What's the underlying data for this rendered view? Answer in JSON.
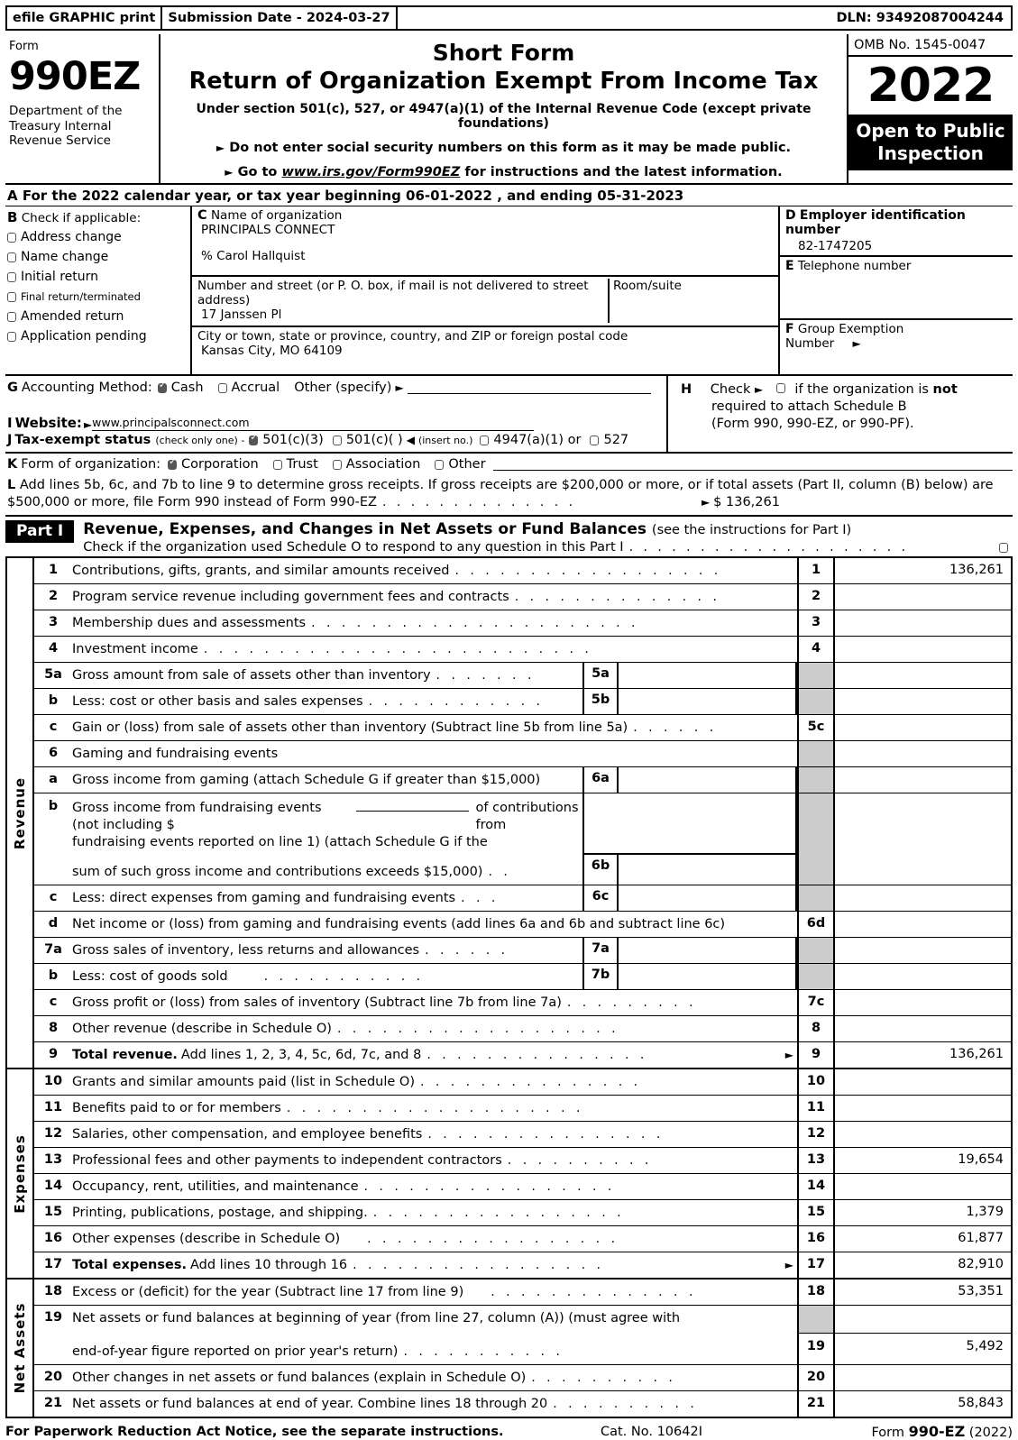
{
  "efile": {
    "graphic_print": "efile GRAPHIC print",
    "submission_date": "Submission Date - 2024-03-27",
    "dln": "DLN: 93492087004244"
  },
  "masthead": {
    "form_label": "Form",
    "form_number": "990EZ",
    "department": "Department of the Treasury Internal Revenue Service",
    "title_line1": "Short Form",
    "title_line2": "Return of Organization Exempt From Income Tax",
    "subtitle": "Under section 501(c), 527, or 4947(a)(1) of the Internal Revenue Code (except private foundations)",
    "notice_ssn": "Do not enter social security numbers on this form as it may be made public.",
    "notice_goto_pre": "Go to ",
    "notice_goto_url": "www.irs.gov/Form990EZ",
    "notice_goto_post": " for instructions and the latest information.",
    "omb": "OMB No. 1545-0047",
    "year": "2022",
    "open_to_public": "Open to Public Inspection"
  },
  "lineA": {
    "letter": "A",
    "text_pre": "For the 2022 calendar year, or tax year beginning",
    "begin_date": "06-01-2022",
    "text_mid": ", and ending",
    "end_date": "05-31-2023"
  },
  "sectionB": {
    "letter": "B",
    "heading": "Check if applicable:",
    "items": [
      {
        "label": "Address change",
        "checked": false
      },
      {
        "label": "Name change",
        "checked": false
      },
      {
        "label": "Initial return",
        "checked": false
      },
      {
        "label": "Final return/terminated",
        "checked": false
      },
      {
        "label": "Amended return",
        "checked": false
      },
      {
        "label": "Application pending",
        "checked": false
      }
    ]
  },
  "sectionC": {
    "letter": "C",
    "name_caption": "Name of organization",
    "org_name": "PRINCIPALS CONNECT",
    "care_of": "% Carol Hallquist",
    "street_caption": "Number and street (or P. O. box, if mail is not delivered to street address)",
    "room_caption": "Room/suite",
    "street": "17 Janssen Pl",
    "room": "",
    "city_caption": "City or town, state or province, country, and ZIP or foreign postal code",
    "city": "Kansas City, MO   64109"
  },
  "sectionD": {
    "letter": "D",
    "caption": "Employer identification number",
    "value": "82-1747205"
  },
  "sectionE": {
    "letter": "E",
    "caption": "Telephone number",
    "value": ""
  },
  "sectionF": {
    "letter": "F",
    "caption_line1": "Group Exemption",
    "caption_line2": "Number"
  },
  "sectionG": {
    "letter": "G",
    "label": "Accounting Method:",
    "cash_label": "Cash",
    "cash_checked": true,
    "accrual_label": "Accrual",
    "accrual_checked": false,
    "other_label": "Other (specify)",
    "other_value": ""
  },
  "sectionH": {
    "letter": "H",
    "line1_pre": "Check",
    "line1_post": "if the organization is ",
    "line1_bold": "not",
    "line2": "required to attach Schedule B",
    "line3": "(Form 990, 990-EZ, or 990-PF).",
    "checked": false
  },
  "sectionI": {
    "letter": "I",
    "label": "Website:",
    "value": "www.principalsconnect.com"
  },
  "sectionJ": {
    "letter": "J",
    "label": "Tax-exempt status",
    "hint": "(check only one) -",
    "opt1": "501(c)(3)",
    "opt1_checked": true,
    "opt2": "501(c)(    )",
    "opt2_checked": false,
    "insert_no": "(insert no.)",
    "opt3": "4947(a)(1) or",
    "opt3_checked": false,
    "opt4": "527",
    "opt4_checked": false
  },
  "sectionK": {
    "letter": "K",
    "label": "Form of organization:",
    "options": [
      {
        "label": "Corporation",
        "checked": true
      },
      {
        "label": "Trust",
        "checked": false
      },
      {
        "label": "Association",
        "checked": false
      },
      {
        "label": "Other",
        "checked": false
      }
    ]
  },
  "sectionL": {
    "letter": "L",
    "line1": "Add lines 5b, 6c, and 7b to line 9 to determine gross receipts. If gross receipts are $200,000 or more, or if total assets (Part II, column (B) below) are",
    "line2": "$500,000 or more, file Form 990 instead of Form 990-EZ",
    "amount": "$ 136,261"
  },
  "partI": {
    "tag": "Part I",
    "title": "Revenue, Expenses, and Changes in Net Assets or Fund Balances",
    "title_note": "(see the instructions for Part I)",
    "check_line": "Check if the organization used Schedule O to respond to any question in this Part I",
    "checked": false
  },
  "revenue": {
    "vertical_label": "Revenue",
    "rows": [
      {
        "no": "1",
        "desc": "Contributions, gifts, grants, and similar amounts received",
        "dots": true,
        "box": "1",
        "amount": "136,261"
      },
      {
        "no": "2",
        "desc": "Program service revenue including government fees and contracts",
        "dots": true,
        "box": "2",
        "amount": ""
      },
      {
        "no": "3",
        "desc": "Membership dues and assessments",
        "dots": true,
        "box": "3",
        "amount": ""
      },
      {
        "no": "4",
        "desc": "Investment income",
        "dots": true,
        "box": "4",
        "amount": ""
      },
      {
        "no": "5a",
        "desc": "Gross amount from sale of assets other than inventory",
        "dots": true,
        "sub": "5a",
        "sub_amount": "",
        "gray": true
      },
      {
        "no": "b",
        "desc": "Less: cost or other basis and sales expenses",
        "dots": true,
        "sub": "5b",
        "sub_amount": "",
        "gray": true
      },
      {
        "no": "c",
        "desc": "Gain or (loss) from sale of assets other than inventory (Subtract line 5b from line 5a)",
        "dots": true,
        "box": "5c",
        "amount": ""
      },
      {
        "no": "6",
        "desc": "Gaming and fundraising events",
        "dots": false,
        "gray": true
      },
      {
        "no": "a",
        "desc": "Gross income from gaming (attach Schedule G if greater than $15,000)",
        "dots": false,
        "sub": "6a",
        "sub_amount": "",
        "gray": true
      },
      {
        "no": "b",
        "desc_l1": "Gross income from fundraising events (not including $",
        "desc_l1b": "of contributions from",
        "desc_l2": "fundraising events reported on line 1) (attach Schedule G if the",
        "desc_l3": "sum of such gross income and contributions exceeds $15,000)",
        "sub": "6b",
        "sub_amount": "",
        "gray": true,
        "multiline": true
      },
      {
        "no": "c",
        "desc": "Less: direct expenses from gaming and fundraising events",
        "dots": true,
        "sub": "6c",
        "sub_amount": "",
        "gray": true
      },
      {
        "no": "d",
        "desc": "Net income or (loss) from gaming and fundraising events (add lines 6a and 6b and subtract line 6c)",
        "dots": false,
        "box": "6d",
        "amount": ""
      },
      {
        "no": "7a",
        "desc": "Gross sales of inventory, less returns and allowances",
        "dots": true,
        "sub": "7a",
        "sub_amount": "",
        "gray": true
      },
      {
        "no": "b",
        "desc": "Less: cost of goods sold",
        "dots": true,
        "sub": "7b",
        "sub_amount": "",
        "gray": true
      },
      {
        "no": "c",
        "desc": "Gross profit or (loss) from sales of inventory (Subtract line 7b from line 7a)",
        "dots": true,
        "box": "7c",
        "amount": ""
      },
      {
        "no": "8",
        "desc": "Other revenue (describe in Schedule O)",
        "dots": true,
        "box": "8",
        "amount": ""
      },
      {
        "no": "9",
        "desc_bold": "Total revenue.",
        "desc": "Add lines 1, 2, 3, 4, 5c, 6d, 7c, and 8",
        "dots": true,
        "arrow": true,
        "box": "9",
        "amount": "136,261"
      }
    ]
  },
  "expenses": {
    "vertical_label": "Expenses",
    "rows": [
      {
        "no": "10",
        "desc": "Grants and similar amounts paid (list in Schedule O)",
        "dots": true,
        "box": "10",
        "amount": ""
      },
      {
        "no": "11",
        "desc": "Benefits paid to or for members",
        "dots": true,
        "box": "11",
        "amount": ""
      },
      {
        "no": "12",
        "desc": "Salaries, other compensation, and employee benefits",
        "dots": true,
        "box": "12",
        "amount": ""
      },
      {
        "no": "13",
        "desc": "Professional fees and other payments to independent contractors",
        "dots": true,
        "box": "13",
        "amount": "19,654"
      },
      {
        "no": "14",
        "desc": "Occupancy, rent, utilities, and maintenance",
        "dots": true,
        "box": "14",
        "amount": ""
      },
      {
        "no": "15",
        "desc": "Printing, publications, postage, and shipping.",
        "dots": true,
        "box": "15",
        "amount": "1,379"
      },
      {
        "no": "16",
        "desc": "Other expenses (describe in Schedule O)",
        "dots": true,
        "box": "16",
        "amount": "61,877"
      },
      {
        "no": "17",
        "desc_bold": "Total expenses.",
        "desc": "Add lines 10 through 16",
        "dots": true,
        "arrow": true,
        "box": "17",
        "amount": "82,910"
      }
    ]
  },
  "netassets": {
    "vertical_label": "Net Assets",
    "rows": [
      {
        "no": "18",
        "desc": "Excess or (deficit) for the year (Subtract line 17 from line 9)",
        "dots": true,
        "box": "18",
        "amount": "53,351"
      },
      {
        "no": "19",
        "desc_l1": "Net assets or fund balances at beginning of year (from line 27, column (A)) (must agree with",
        "desc_l2": "end-of-year figure reported on prior year's return)",
        "multiline": true,
        "box": "19",
        "amount": "5,492"
      },
      {
        "no": "20",
        "desc": "Other changes in net assets or fund balances (explain in Schedule O)",
        "dots": true,
        "box": "20",
        "amount": ""
      },
      {
        "no": "21",
        "desc": "Net assets or fund balances at end of year. Combine lines 18 through 20",
        "dots": true,
        "box": "21",
        "amount": "58,843"
      }
    ]
  },
  "footer": {
    "notice": "For Paperwork Reduction Act Notice, see the separate instructions.",
    "cat": "Cat. No. 10642I",
    "form_pre": "Form ",
    "form_bold": "990-EZ",
    "form_year": " (2022)"
  }
}
